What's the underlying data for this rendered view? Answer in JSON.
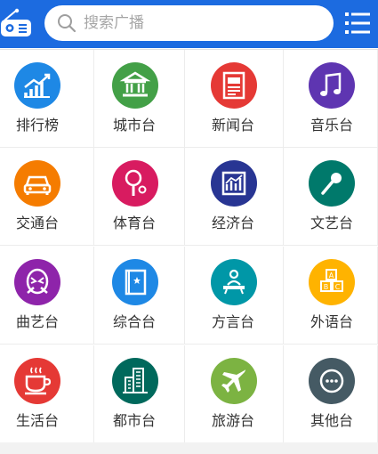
{
  "header": {
    "search_placeholder": "搜索广播",
    "colors": {
      "bar": "#1c6be0"
    }
  },
  "categories": [
    {
      "label": "排行榜",
      "icon": "ranking-chart-icon",
      "color": "#1e88e5"
    },
    {
      "label": "城市台",
      "icon": "city-building-icon",
      "color": "#43a047"
    },
    {
      "label": "新闻台",
      "icon": "newspaper-icon",
      "color": "#e53935"
    },
    {
      "label": "音乐台",
      "icon": "music-note-icon",
      "color": "#5e35b1"
    },
    {
      "label": "交通台",
      "icon": "car-icon",
      "color": "#f57c00"
    },
    {
      "label": "体育台",
      "icon": "tennis-racket-icon",
      "color": "#d81b60"
    },
    {
      "label": "经济台",
      "icon": "economy-chart-icon",
      "color": "#283593"
    },
    {
      "label": "文艺台",
      "icon": "microphone-icon",
      "color": "#00796b"
    },
    {
      "label": "曲艺台",
      "icon": "opera-mask-icon",
      "color": "#8e24aa"
    },
    {
      "label": "综合台",
      "icon": "book-icon",
      "color": "#1e88e5"
    },
    {
      "label": "方言台",
      "icon": "speaker-person-icon",
      "color": "#0097a7"
    },
    {
      "label": "外语台",
      "icon": "abc-blocks-icon",
      "color": "#ffb300"
    },
    {
      "label": "生活台",
      "icon": "coffee-cup-icon",
      "color": "#e53935"
    },
    {
      "label": "都市台",
      "icon": "city-skyline-icon",
      "color": "#00695c"
    },
    {
      "label": "旅游台",
      "icon": "airplane-icon",
      "color": "#7cb342"
    },
    {
      "label": "其他台",
      "icon": "more-dots-icon",
      "color": "#455a64"
    }
  ]
}
